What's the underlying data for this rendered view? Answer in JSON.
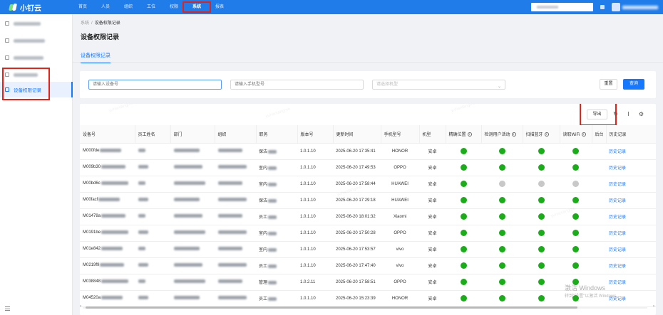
{
  "app": {
    "name": "小钉云"
  },
  "topnav": {
    "items": [
      "首页",
      "人员",
      "组织",
      "工位",
      "权限",
      "系统",
      "报表"
    ],
    "active_index": 5
  },
  "breadcrumb": {
    "root": "系统",
    "separator": "/",
    "current": "设备权限记录"
  },
  "page": {
    "title": "设备权限记录",
    "tab": "设备权限记录"
  },
  "sidebar": {
    "active_label": "设备权限记录"
  },
  "filters": {
    "device_placeholder": "请输入设备号",
    "phone_placeholder": "请输入手机型号",
    "model_placeholder": "请选择机型",
    "reset_label": "重置",
    "query_label": "查询"
  },
  "toolbar": {
    "export_label": "导出"
  },
  "table": {
    "columns": [
      "设备号",
      "员工姓名",
      "部门",
      "组织",
      "职务",
      "版本号",
      "更新时间",
      "手机型号",
      "机型",
      "精确位置",
      "检测用户活动",
      "扫描蓝牙",
      "读取WiFi",
      "后台",
      "历史记录"
    ],
    "rows": [
      {
        "device": "M000fde",
        "position": "保洁",
        "version": "1.0.1.10",
        "time": "2025-06-20 17:35:41",
        "phone": "HONOR",
        "model": "安卓",
        "perms": [
          true,
          true,
          true,
          true
        ],
        "history": "历史记录"
      },
      {
        "device": "M009b30",
        "position": "室内",
        "version": "1.0.1.10",
        "time": "2025-06-20 17:49:53",
        "phone": "OPPO",
        "model": "安卓",
        "perms": [
          true,
          true,
          true,
          true
        ],
        "history": "历史记录"
      },
      {
        "device": "M00bd6c",
        "position": "室内",
        "version": "1.0.1.10",
        "time": "2025-06-20 17:58:44",
        "phone": "HUAWEI",
        "model": "安卓",
        "perms": [
          true,
          false,
          false,
          false
        ],
        "history": "历史记录"
      },
      {
        "device": "M00facf",
        "position": "保洁",
        "version": "1.0.1.10",
        "time": "2025-06-20 17:29:18",
        "phone": "HUAWEI",
        "model": "安卓",
        "perms": [
          true,
          true,
          true,
          true
        ],
        "history": "历史记录"
      },
      {
        "device": "M01478a",
        "position": "员工",
        "version": "1.0.1.10",
        "time": "2025-06-20 18:01:32",
        "phone": "Xiaomi",
        "model": "安卓",
        "perms": [
          true,
          true,
          true,
          true
        ],
        "history": "历史记录"
      },
      {
        "device": "M0191be",
        "position": "室内",
        "version": "1.0.1.10",
        "time": "2025-06-20 17:50:28",
        "phone": "OPPO",
        "model": "安卓",
        "perms": [
          true,
          true,
          true,
          true
        ],
        "history": "历史记录"
      },
      {
        "device": "M01e842",
        "position": "室内",
        "version": "1.0.1.10",
        "time": "2025-06-20 17:53:57",
        "phone": "vivo",
        "model": "安卓",
        "perms": [
          true,
          true,
          true,
          true
        ],
        "history": "历史记录"
      },
      {
        "device": "M0219f9",
        "position": "员工",
        "version": "1.0.1.10",
        "time": "2025-06-20 17:47:40",
        "phone": "vivo",
        "model": "安卓",
        "perms": [
          true,
          true,
          true,
          true
        ],
        "history": "历史记录"
      },
      {
        "device": "M038848",
        "position": "管理",
        "version": "1.0.2.11",
        "time": "2025-06-20 17:58:51",
        "phone": "OPPO",
        "model": "安卓",
        "perms": [
          true,
          true,
          true,
          true
        ],
        "history": "历史记录"
      },
      {
        "device": "M04520a",
        "position": "员工",
        "version": "1.0.1.10",
        "time": "2025-06-20 15:23:39",
        "phone": "HONOR",
        "model": "安卓",
        "perms": [
          true,
          true,
          true,
          true
        ],
        "history": "历史记录"
      }
    ]
  },
  "watermark": "yuhanlangmo",
  "windows": {
    "line1": "激活 Windows",
    "line2": "转到\"设置\"以激活 Windows。"
  },
  "colors": {
    "primary": "#1677ff",
    "topbar": "#1f7ce8",
    "dot_on": "#1aad19",
    "dot_off": "#c8c8c8",
    "highlight": "#e2231a"
  }
}
